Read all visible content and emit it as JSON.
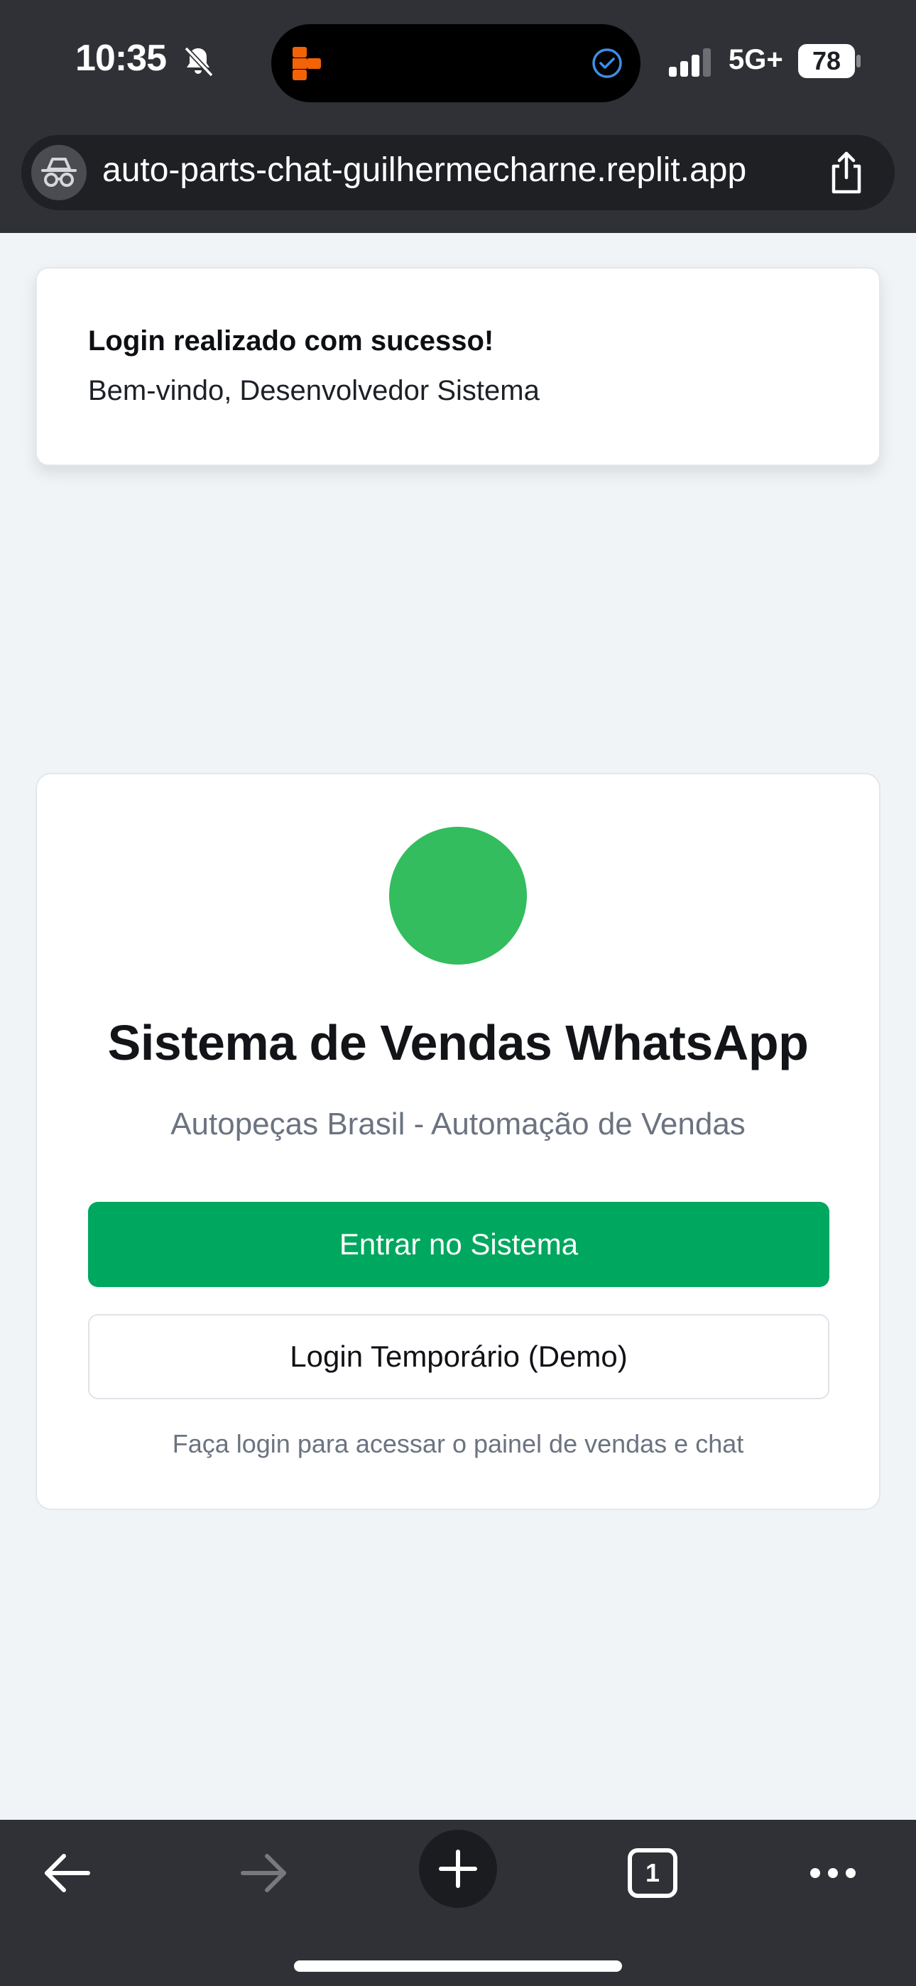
{
  "status_bar": {
    "time": "10:35",
    "network": "5G+",
    "battery": "78",
    "icons": [
      "bell-off-icon",
      "replit-icon",
      "verified-icon",
      "signal-icon",
      "battery-icon"
    ]
  },
  "browser": {
    "url": "auto-parts-chat-guilhermecharne.replit.app",
    "icons": [
      "incognito-icon",
      "share-icon"
    ],
    "toolbar": {
      "tab_count": "1",
      "icons": [
        "back-arrow-icon",
        "forward-arrow-icon",
        "plus-icon",
        "tabs-icon",
        "more-icon"
      ]
    }
  },
  "toast": {
    "title": "Login realizado com sucesso!",
    "message": "Bem-vindo, Desenvolvedor Sistema"
  },
  "login_card": {
    "title": "Sistema de Vendas WhatsApp",
    "subtitle": "Autopeças Brasil - Automação de Vendas",
    "primary_button": "Entrar no Sistema",
    "secondary_button": "Login Temporário (Demo)",
    "footnote": "Faça login para acessar o painel de vendas e chat"
  },
  "colors": {
    "chrome": "#2f3136",
    "background": "#f1f4f7",
    "brand_green": "#33bd5e",
    "primary_button": "#00a75f",
    "muted_text": "#6c7380"
  }
}
